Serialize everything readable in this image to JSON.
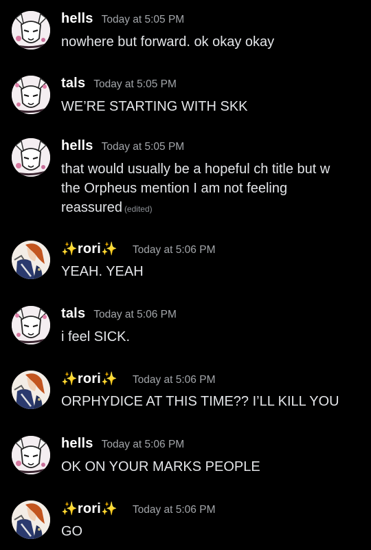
{
  "messages": [
    {
      "author": "hells",
      "author_type": "hells",
      "timestamp": "Today at 5:05 PM",
      "lines": [
        "nowhere but forward. ok okay okay"
      ]
    },
    {
      "author": "tals",
      "author_type": "tals",
      "timestamp": "Today at 5:05 PM",
      "lines": [
        "WE’RE STARTING WITH SKK"
      ]
    },
    {
      "author": "hells",
      "author_type": "hells",
      "timestamp": "Today at 5:05 PM",
      "lines": [
        "that would usually be a hopeful ch title but w",
        "the Orpheus mention I am not feeling",
        "reassured"
      ],
      "edited": "(edited)"
    },
    {
      "author": "rori",
      "author_type": "rori",
      "decoration": "✨",
      "timestamp": "Today at 5:06 PM",
      "lines": [
        "YEAH. YEAH"
      ]
    },
    {
      "author": "tals",
      "author_type": "tals",
      "timestamp": "Today at 5:06 PM",
      "lines": [
        "i feel SICK."
      ]
    },
    {
      "author": "rori",
      "author_type": "rori",
      "decoration": "✨",
      "timestamp": "Today at 5:06 PM",
      "lines": [
        "ORPHYDICE AT THIS TIME?? I’LL KILL YOU"
      ]
    },
    {
      "author": "hells",
      "author_type": "hells",
      "timestamp": "Today at 5:06 PM",
      "lines": [
        "OK ON YOUR MARKS PEOPLE"
      ]
    },
    {
      "author": "rori",
      "author_type": "rori",
      "decoration": "✨",
      "timestamp": "Today at 5:06 PM",
      "lines": [
        "GO"
      ]
    }
  ],
  "colors": {
    "background": "#000000",
    "username": "#ffffff",
    "timestamp": "#a3a6aa",
    "text": "#e3e5e8",
    "sparkle": "#f5c400"
  }
}
